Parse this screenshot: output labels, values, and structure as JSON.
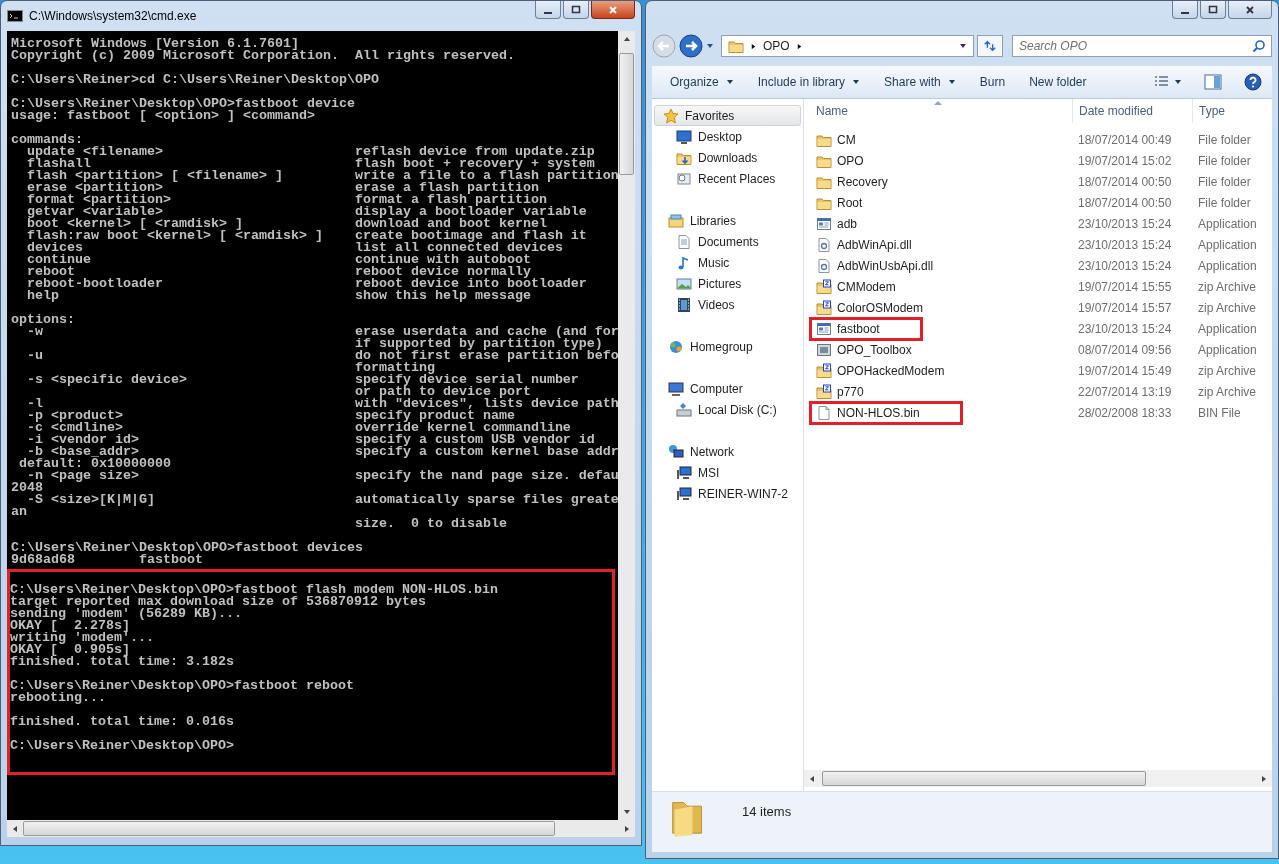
{
  "cmd_window": {
    "title": "C:\\Windows\\system32\\cmd.exe",
    "active": true,
    "sections": [
      {
        "highlighted": false,
        "paragraphs": [
          [
            {
              "text": "Microsoft Windows [Version 6.1.7601]"
            },
            {
              "text": "Copyright (c) 2009 Microsoft Corporation.  All rights reserved."
            }
          ],
          [
            {
              "text": "C:\\Users\\Reiner>cd C:\\Users\\Reiner\\Desktop\\OPO"
            }
          ],
          [
            {
              "text": "C:\\Users\\Reiner\\Desktop\\OPO>fastboot device"
            },
            {
              "text": "usage: fastboot [ <option> ] <command>"
            }
          ],
          [
            {
              "text": "commands:"
            },
            {
              "text": "  update <filename>",
              "note": "reflash device from update.zip"
            },
            {
              "text": "  flashall",
              "note": "flash boot + recovery + system"
            },
            {
              "text": "  flash <partition> [ <filename> ]",
              "note": "write a file to a flash partition"
            },
            {
              "text": "  erase <partition>",
              "note": "erase a flash partition"
            },
            {
              "text": "  format <partition>",
              "note": "format a flash partition"
            },
            {
              "text": "  getvar <variable>",
              "note": "display a bootloader variable"
            },
            {
              "text": "  boot <kernel> [ <ramdisk> ]",
              "note": "download and boot kernel"
            },
            {
              "text": "  flash:raw boot <kernel> [ <ramdisk> ]",
              "note": "create bootimage and flash it"
            },
            {
              "text": "  devices",
              "note": "list all connected devices"
            },
            {
              "text": "  continue",
              "note": "continue with autoboot"
            },
            {
              "text": "  reboot",
              "note": "reboot device normally"
            },
            {
              "text": "  reboot-bootloader",
              "note": "reboot device into bootloader"
            },
            {
              "text": "  help",
              "note": "show this help message"
            }
          ],
          [
            {
              "text": "options:"
            },
            {
              "text": "  -w",
              "note": "erase userdata and cache (and for"
            },
            {
              "note": "if supported by partition type)"
            },
            {
              "text": "  -u",
              "note": "do not first erase partition befo"
            },
            {
              "note": "formatting"
            },
            {
              "text": "  -s <specific device>",
              "note": "specify device serial number"
            },
            {
              "note": "or path to device port"
            },
            {
              "text": "  -l",
              "note": "with \"devices\", lists device path"
            },
            {
              "text": "  -p <product>",
              "note": "specify product name"
            },
            {
              "text": "  -c <cmdline>",
              "note": "override kernel commandline"
            },
            {
              "text": "  -i <vendor id>",
              "note": "specify a custom USB vendor id"
            },
            {
              "text": "  -b <base_addr>",
              "note": "specify a custom kernel base addr"
            },
            {
              "text": " default: 0x10000000"
            },
            {
              "text": "  -n <page size>",
              "note": "specify the nand page size. defau"
            },
            {
              "text": "2048"
            },
            {
              "text": "  -S <size>[K|M|G]",
              "note": "automatically sparse files greate"
            },
            {
              "text": "an"
            },
            {
              "note": "size.  0 to disable"
            }
          ],
          [
            {
              "text": "C:\\Users\\Reiner\\Desktop\\OPO>fastboot devices"
            },
            {
              "text": "9d68ad68        fastboot"
            }
          ]
        ]
      },
      {
        "highlighted": true,
        "paragraphs": [
          [
            {
              "text": "C:\\Users\\Reiner\\Desktop\\OPO>fastboot flash modem NON-HLOS.bin"
            },
            {
              "text": "target reported max download size of 536870912 bytes"
            },
            {
              "text": "sending 'modem' (56289 KB)..."
            },
            {
              "text": "OKAY [  2.278s]"
            },
            {
              "text": "writing 'modem'..."
            },
            {
              "text": "OKAY [  0.905s]"
            },
            {
              "text": "finished. total time: 3.182s"
            }
          ],
          [
            {
              "text": "C:\\Users\\Reiner\\Desktop\\OPO>fastboot reboot"
            },
            {
              "text": "rebooting..."
            }
          ],
          [
            {
              "text": "finished. total time: 0.016s"
            }
          ],
          [
            {
              "text": "C:\\Users\\Reiner\\Desktop\\OPO>"
            }
          ]
        ]
      }
    ]
  },
  "explorer": {
    "active": false,
    "address": [
      "OPO"
    ],
    "search": {
      "placeholder": "Search OPO"
    },
    "toolbar": [
      {
        "label": "Organize",
        "dropdown": true
      },
      {
        "label": "Include in library",
        "dropdown": true
      },
      {
        "label": "Share with",
        "dropdown": true
      },
      {
        "label": "Burn",
        "dropdown": false
      },
      {
        "label": "New folder",
        "dropdown": false
      }
    ],
    "nav": [
      {
        "label": "Favorites",
        "kind": "star",
        "selected": true,
        "children": [
          {
            "label": "Desktop",
            "kind": "desktop",
            "selected": false
          },
          {
            "label": "Downloads",
            "kind": "downloads",
            "selected": false
          },
          {
            "label": "Recent Places",
            "kind": "recent",
            "selected": false
          }
        ]
      },
      {
        "label": "Libraries",
        "kind": "libraries",
        "selected": false,
        "children": [
          {
            "label": "Documents",
            "kind": "documents",
            "selected": false
          },
          {
            "label": "Music",
            "kind": "music",
            "selected": false
          },
          {
            "label": "Pictures",
            "kind": "pictures",
            "selected": false
          },
          {
            "label": "Videos",
            "kind": "videos",
            "selected": false
          }
        ]
      },
      {
        "label": "Homegroup",
        "kind": "homegroup",
        "selected": false
      },
      {
        "label": "Computer",
        "kind": "computer",
        "selected": false,
        "children": [
          {
            "label": "Local Disk (C:)",
            "kind": "disk",
            "selected": false
          }
        ]
      },
      {
        "label": "Network",
        "kind": "network",
        "selected": false,
        "children": [
          {
            "label": "MSI",
            "kind": "pc",
            "selected": false
          },
          {
            "label": "REINER-WIN7-2",
            "kind": "pc",
            "selected": false
          }
        ]
      }
    ],
    "columns": [
      "Name",
      "Date modified",
      "Type"
    ],
    "files": [
      {
        "name": "CM",
        "date": "18/07/2014 00:49",
        "type": "File folder",
        "kind": "folder",
        "highlighted": false
      },
      {
        "name": "OPO",
        "date": "19/07/2014 15:02",
        "type": "File folder",
        "kind": "folder",
        "highlighted": false
      },
      {
        "name": "Recovery",
        "date": "18/07/2014 00:50",
        "type": "File folder",
        "kind": "folder",
        "highlighted": false
      },
      {
        "name": "Root",
        "date": "18/07/2014 00:50",
        "type": "File folder",
        "kind": "folder",
        "highlighted": false
      },
      {
        "name": "adb",
        "date": "23/10/2013 15:24",
        "type": "Application",
        "kind": "app",
        "highlighted": false
      },
      {
        "name": "AdbWinApi.dll",
        "date": "23/10/2013 15:24",
        "type": "Application",
        "kind": "dll",
        "highlighted": false
      },
      {
        "name": "AdbWinUsbApi.dll",
        "date": "23/10/2013 15:24",
        "type": "Application",
        "kind": "dll",
        "highlighted": false
      },
      {
        "name": "CMModem",
        "date": "19/07/2014 15:55",
        "type": "zip Archive",
        "kind": "zip",
        "highlighted": false
      },
      {
        "name": "ColorOSModem",
        "date": "19/07/2014 15:57",
        "type": "zip Archive",
        "kind": "zip",
        "highlighted": false
      },
      {
        "name": "fastboot",
        "date": "23/10/2013 15:24",
        "type": "Application",
        "kind": "app",
        "highlighted": true
      },
      {
        "name": "OPO_Toolbox",
        "date": "08/07/2014 09:56",
        "type": "Application",
        "kind": "toolbox",
        "highlighted": false
      },
      {
        "name": "OPOHackedModem",
        "date": "19/07/2014 15:49",
        "type": "zip Archive",
        "kind": "zip",
        "highlighted": false
      },
      {
        "name": "p770",
        "date": "22/07/2014 13:19",
        "type": "zip Archive",
        "kind": "zip",
        "highlighted": false
      },
      {
        "name": "NON-HLOS.bin",
        "date": "28/02/2008 18:33",
        "type": "BIN File",
        "kind": "bin",
        "highlighted": true
      }
    ],
    "status": "14 items"
  }
}
